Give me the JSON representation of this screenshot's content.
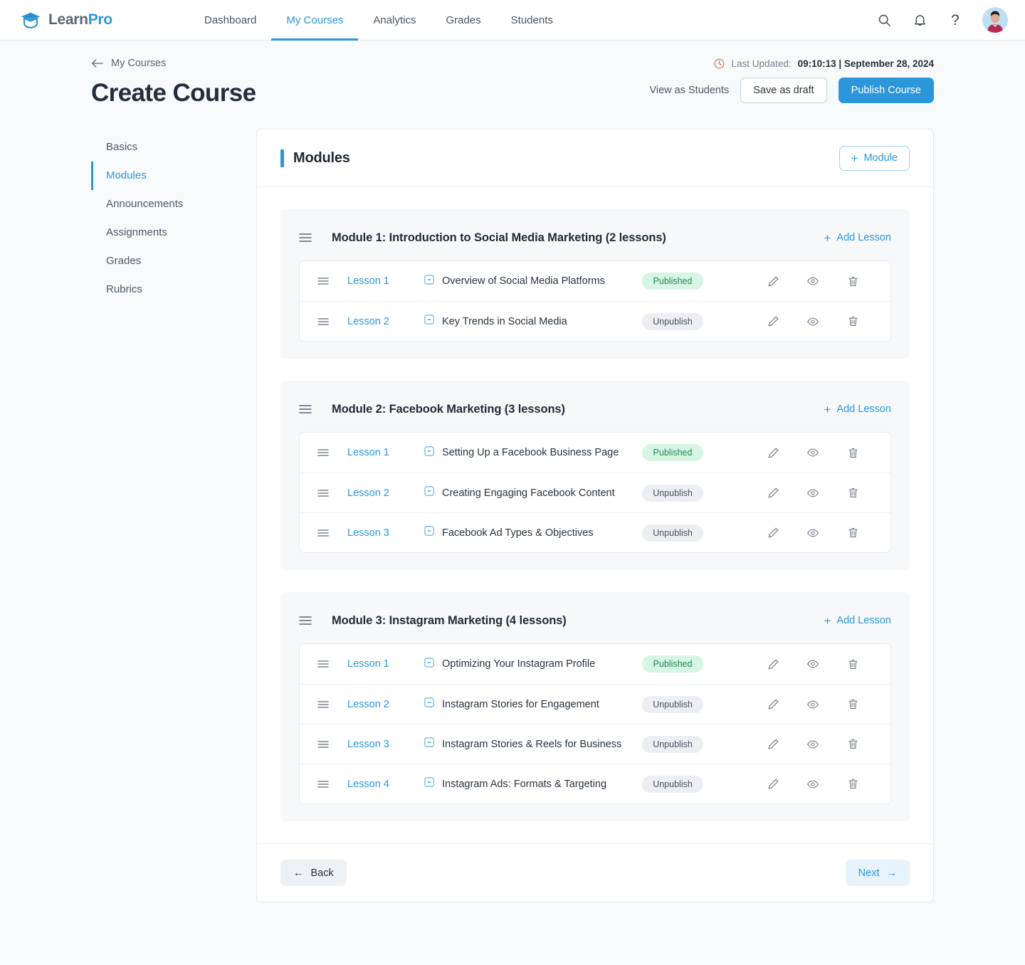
{
  "brand": {
    "name_first": "Learn",
    "name_second": "Pro",
    "logo_icon": "graduation-cap-icon"
  },
  "topnav": {
    "items": [
      {
        "label": "Dashboard",
        "active": false
      },
      {
        "label": "My Courses",
        "active": true
      },
      {
        "label": "Analytics",
        "active": false
      },
      {
        "label": "Grades",
        "active": false
      },
      {
        "label": "Students",
        "active": false
      }
    ],
    "search_icon": "search-icon",
    "notifications_icon": "bell-icon",
    "help_icon": "question-mark-icon",
    "help_glyph": "?",
    "avatar": "user-avatar"
  },
  "header": {
    "breadcrumb_label": "My Courses",
    "back_arrow_icon": "arrow-left-icon",
    "page_title": "Create Course",
    "clock_icon": "clock-icon",
    "updated_label": "Last Updated:",
    "updated_value": "09:10:13 |  September 28, 2024",
    "view_as_students": "View as Students",
    "save_draft": "Save as draft",
    "publish_course": "Publish Course"
  },
  "sidenav": {
    "items": [
      {
        "label": "Basics",
        "active": false
      },
      {
        "label": "Modules",
        "active": true
      },
      {
        "label": "Announcements",
        "active": false
      },
      {
        "label": "Assignments",
        "active": false
      },
      {
        "label": "Grades",
        "active": false
      },
      {
        "label": "Rubrics",
        "active": false
      }
    ]
  },
  "modules_card": {
    "title": "Modules",
    "add_module_label": "Module",
    "add_module_plus": "+",
    "add_lesson_label": "Add Lesson",
    "add_lesson_plus": "+",
    "back_label": "Back",
    "next_label": "Next",
    "back_arrow": "←",
    "next_arrow": "→"
  },
  "modules": [
    {
      "title": "Module 1: Introduction to Social Media Marketing (2 lessons)",
      "lessons": [
        {
          "num": "Lesson 1",
          "title": "Overview of Social Media Platforms",
          "status": "Published",
          "status_type": "published"
        },
        {
          "num": "Lesson 2",
          "title": "Key Trends in Social Media",
          "status": "Unpublish",
          "status_type": "unpublish"
        }
      ]
    },
    {
      "title": "Module 2: Facebook Marketing (3 lessons)",
      "lessons": [
        {
          "num": "Lesson 1",
          "title": "Setting Up a Facebook Business Page",
          "status": "Published",
          "status_type": "published"
        },
        {
          "num": "Lesson 2",
          "title": "Creating Engaging Facebook Content",
          "status": "Unpublish",
          "status_type": "unpublish"
        },
        {
          "num": "Lesson 3",
          "title": "Facebook Ad Types & Objectives",
          "status": "Unpublish",
          "status_type": "unpublish"
        }
      ]
    },
    {
      "title": "Module 3: Instagram Marketing (4 lessons)",
      "lessons": [
        {
          "num": "Lesson 1",
          "title": "Optimizing Your Instagram Profile",
          "status": "Published",
          "status_type": "published"
        },
        {
          "num": "Lesson 2",
          "title": "Instagram Stories for Engagement",
          "status": "Unpublish",
          "status_type": "unpublish"
        },
        {
          "num": "Lesson 3",
          "title": "Instagram Stories & Reels for Business",
          "status": "Unpublish",
          "status_type": "unpublish"
        },
        {
          "num": "Lesson 4",
          "title": "Instagram Ads: Formats & Targeting",
          "status": "Unpublish",
          "status_type": "unpublish"
        }
      ]
    }
  ],
  "icons": {
    "lesson_type_icon": "media-square-icon",
    "edit_icon": "pencil-icon",
    "preview_icon": "eye-icon",
    "delete_icon": "trash-icon",
    "drag_icon": "drag-handle-icon"
  },
  "colors": {
    "accent": "#2b96d9",
    "published_bg": "#d6f5e3",
    "published_text": "#1f8a52",
    "unpublish_bg": "#eceef1",
    "unpublish_text": "#4c5562",
    "page_bg": "#f7f9fb"
  }
}
